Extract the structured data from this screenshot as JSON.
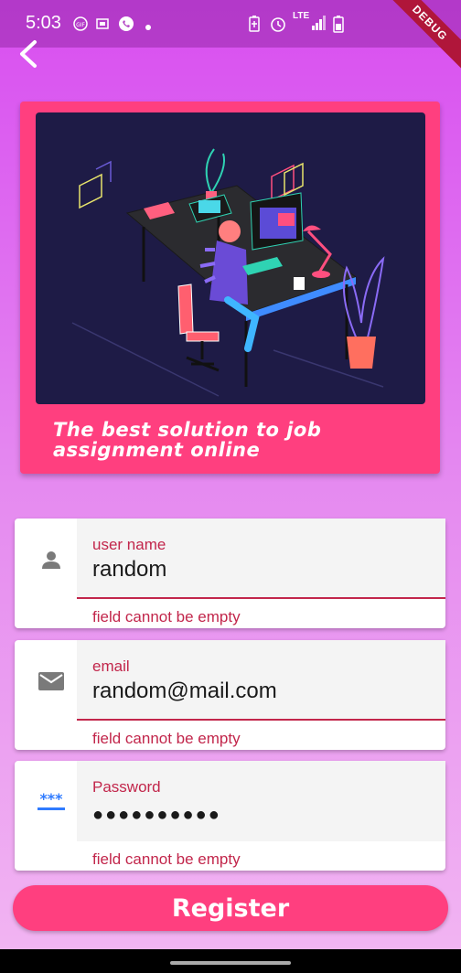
{
  "status_bar": {
    "time": "5:03",
    "left_icons": [
      "gif-icon",
      "cast-icon",
      "whatsapp-icon",
      "dot-icon"
    ],
    "network": "LTE",
    "right_icons": [
      "battery-saver-icon",
      "alarm-icon",
      "lte-icon",
      "signal-icon",
      "battery-icon"
    ]
  },
  "debug_banner": "DEBUG",
  "hero": {
    "caption": "The best solution to job assignment online"
  },
  "form": {
    "fields": [
      {
        "label": "user name",
        "value": "random",
        "error": "field cannot be empty",
        "icon": "person-icon"
      },
      {
        "label": "email",
        "value": "random@mail.com",
        "error": "field cannot be empty",
        "icon": "mail-icon"
      },
      {
        "label": "Password",
        "value": "●●●●●●●●●●",
        "error": "field cannot be empty",
        "icon": "password-icon"
      }
    ],
    "submit_label": "Register"
  },
  "colors": {
    "accent": "#ff3f7f",
    "error": "#c2264b",
    "hero_background": "#1e1b46"
  }
}
